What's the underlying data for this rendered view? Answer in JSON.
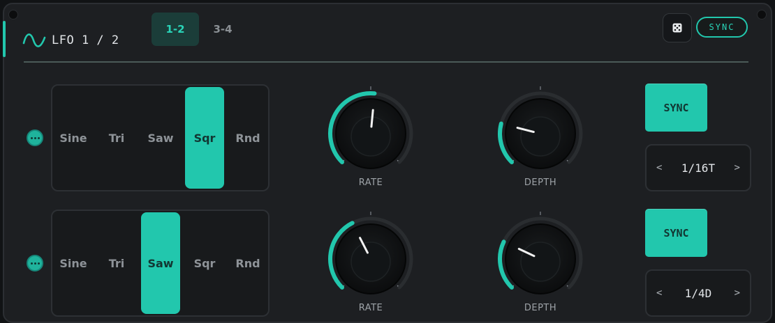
{
  "header": {
    "title": "LFO 1 / 2",
    "tabs": [
      {
        "label": "1-2",
        "active": true
      },
      {
        "label": "3-4",
        "active": false
      }
    ],
    "sync_label": "SYNC",
    "dice_icon": "dice-icon"
  },
  "lfos": [
    {
      "waves": [
        "Sine",
        "Tri",
        "Saw",
        "Sqr",
        "Rnd"
      ],
      "selected_wave": "Sqr",
      "rate": {
        "label": "RATE",
        "value": 0.52
      },
      "depth": {
        "label": "DEPTH",
        "value": 0.22
      },
      "sync_label": "SYNC",
      "division": {
        "prev": "<",
        "value": "1/16T",
        "next": ">"
      }
    },
    {
      "waves": [
        "Sine",
        "Tri",
        "Saw",
        "Sqr",
        "Rnd"
      ],
      "selected_wave": "Saw",
      "rate": {
        "label": "RATE",
        "value": 0.4
      },
      "depth": {
        "label": "DEPTH",
        "value": 0.26
      },
      "sync_label": "SYNC",
      "division": {
        "prev": "<",
        "value": "1/4D",
        "next": ">"
      }
    }
  ],
  "colors": {
    "accent": "#22c7ad",
    "panel": "#1d1f22",
    "background": "#111315"
  }
}
